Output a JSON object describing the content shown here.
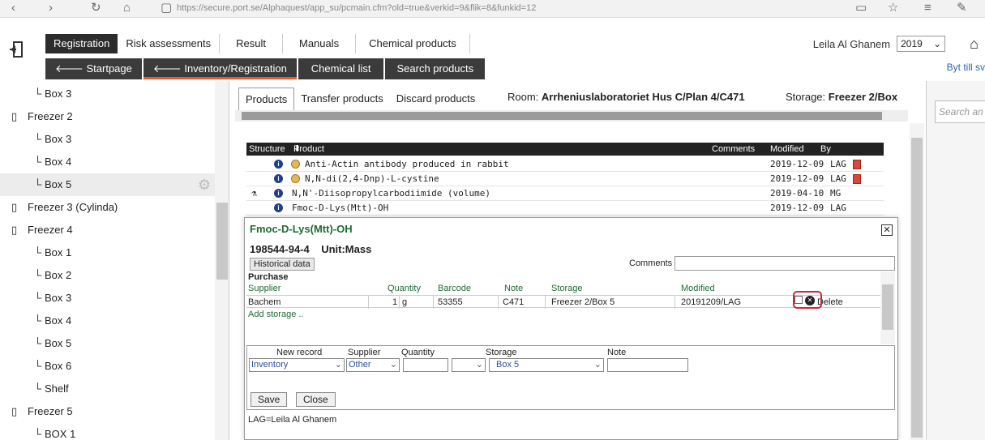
{
  "browser": {
    "url": "https://secure.port.se/Alphaquest/app_su/pcmain.cfm?old=true&verkid=9&flik=8&funkid=12"
  },
  "header": {
    "menu_tabs": [
      "Registration",
      "Risk assessments",
      "Result",
      "Manuals",
      "Chemical products"
    ],
    "sub_tabs": [
      "Startpage",
      "Inventory/Registration",
      "Chemical list",
      "Search products"
    ],
    "user_name": "Leila Al Ghanem",
    "year": "2019",
    "switch_link": "Byt till sv"
  },
  "sidebar": {
    "items": [
      {
        "label": "Box 3",
        "level": 2
      },
      {
        "label": "Freezer 2",
        "level": 1
      },
      {
        "label": "Box 3",
        "level": 2
      },
      {
        "label": "Box 4",
        "level": 2
      },
      {
        "label": "Box 5",
        "level": 2,
        "selected": true
      },
      {
        "label": "Freezer 3 (Cylinda)",
        "level": 1
      },
      {
        "label": "Freezer 4",
        "level": 1
      },
      {
        "label": "Box 1",
        "level": 2
      },
      {
        "label": "Box 2",
        "level": 2
      },
      {
        "label": "Box 3",
        "level": 2
      },
      {
        "label": "Box 4",
        "level": 2
      },
      {
        "label": "Box 5",
        "level": 2
      },
      {
        "label": "Box 6",
        "level": 2
      },
      {
        "label": "Shelf",
        "level": 2
      },
      {
        "label": "Freezer 5",
        "level": 1
      },
      {
        "label": "BOX 1",
        "level": 2
      }
    ]
  },
  "main": {
    "tabs": [
      "Products",
      "Transfer products",
      "Discard products"
    ],
    "room_label": "Room:",
    "room_value": "Arrheniuslaboratoriet Hus C/Plan 4/C471",
    "storage_label": "Storage:",
    "storage_value": "Freezer 2/Box",
    "table": {
      "headers": [
        "Structure",
        "Product",
        "Comments",
        "Modified",
        "By"
      ],
      "rows": [
        {
          "product": "Anti-Actin antibody produced in rabbit",
          "modified": "2019-12-09",
          "by": "LAG"
        },
        {
          "product": "N,N-di(2,4-Dnp)-L-cystine",
          "modified": "2019-12-09",
          "by": "LAG"
        },
        {
          "product": "N,N'-Diisopropylcarbodiimide (volume)",
          "modified": "2019-04-10",
          "by": "MG"
        },
        {
          "product": "Fmoc-D-Lys(Mtt)-OH",
          "modified": "2019-12-09",
          "by": "LAG"
        }
      ]
    }
  },
  "popup": {
    "title": "Fmoc-D-Lys(Mtt)-OH",
    "cas": "198544-94-4",
    "unit": "Unit:Mass",
    "historical_button": "Historical data",
    "comments_label": "Comments",
    "purchase_label": "Purchase",
    "purchase_headers": [
      "Supplier",
      "Quantity",
      "Barcode",
      "Note",
      "Storage",
      "Modified"
    ],
    "purchase_row": {
      "supplier": "Bachem",
      "quantity": "1",
      "unit": "g",
      "barcode": "53355",
      "note": "C471",
      "storage": "Freezer 2/Box 5",
      "modified": "20191209/LAG",
      "delete_label": "Delete"
    },
    "add_storage": "Add storage ..",
    "new_record": {
      "headers": [
        "New record",
        "Supplier",
        "Quantity",
        "Storage",
        "Note"
      ],
      "type_value": "Inventory",
      "supplier_value": "Other",
      "storage_value": "Box 5"
    },
    "save_label": "Save",
    "close_label": "Close",
    "legend": "LAG=Leila Al Ghanem"
  },
  "right_panel": {
    "search_placeholder": "Search an"
  }
}
